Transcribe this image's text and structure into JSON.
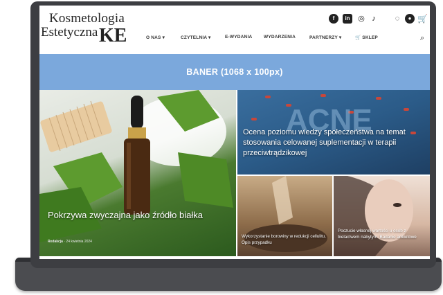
{
  "logo": {
    "line1": "Kosmetologia",
    "line2": "Estetyczna",
    "mark": "KE"
  },
  "social_icons": [
    "facebook-icon",
    "linkedin-icon",
    "instagram-icon",
    "tiktok-icon",
    "messenger-icon",
    "user-icon",
    "cart-icon"
  ],
  "nav": {
    "items": [
      {
        "label": "O NAS ▾"
      },
      {
        "label": "CZYTELNIA ▾"
      },
      {
        "label": "E-WYDANIA"
      },
      {
        "label": "WYDARZENIA"
      },
      {
        "label": "PARTNERZY ▾"
      },
      {
        "label": "🛒 SKLEP"
      }
    ],
    "search_icon": "search-icon"
  },
  "banner": {
    "text": "BANER  (1068 x 100px)"
  },
  "articles": {
    "main": {
      "title": "Pokrzywa zwyczajna jako źródło białka",
      "author": "Redakcja",
      "date": "24 kwietnia 2024"
    },
    "acne": {
      "title": "Ocena poziomu wiedzy społeczeństwa na temat stosowania celowanej suplementacji w terapii przeciwtrądzikowej"
    },
    "mud": {
      "title": "Wykorzystanie borowiny w redukcji cellulitu. Opis przypadku"
    },
    "face": {
      "title": "Poczucie własnej wartości u osób z bielactwem nabytym. Badanie ankietowe"
    }
  },
  "colors": {
    "banner": "#7ba8dc",
    "laptop": "#4b4c50",
    "logo_accent": "#d8a62c"
  }
}
